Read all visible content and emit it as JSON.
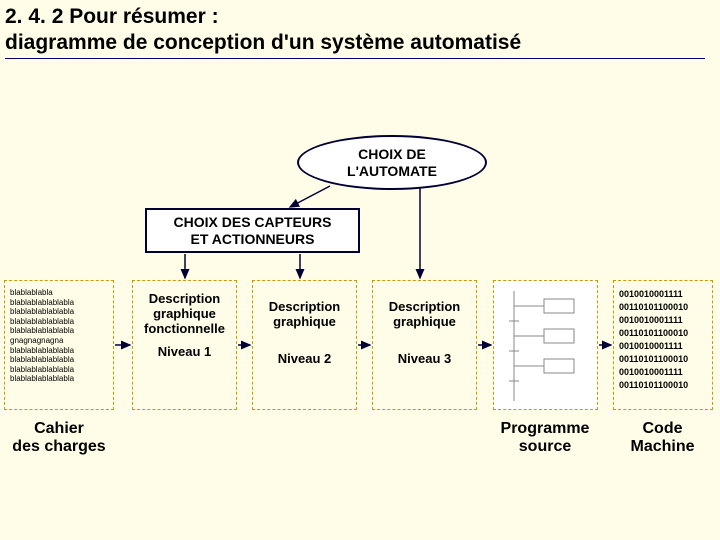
{
  "title_line1": "2. 4. 2 Pour résumer :",
  "title_line2": "diagramme de conception d'un système  automatisé",
  "oval_line1": "CHOIX DE",
  "oval_line2": "L'AUTOMATE",
  "rect_line1": "CHOIX DES CAPTEURS",
  "rect_line2": "ET ACTIONNEURS",
  "cahier_lines": [
    "blablablabla",
    "blablablablablabla",
    "blablablablablabla",
    "blablablablablabla",
    "blablablablablabla",
    "gnagnagnagna",
    "blablablablablabla",
    "blablablablablabla",
    "blablablablablabla",
    "blablablablablabla"
  ],
  "desc1_l1": "Description",
  "desc1_l2": "graphique",
  "desc1_l3": "fonctionnelle",
  "desc2_l1": "Description",
  "desc2_l2": "graphique",
  "desc3_l1": "Description",
  "desc3_l2": "graphique",
  "niveau1": "Niveau 1",
  "niveau2": "Niveau 2",
  "niveau3": "Niveau 3",
  "code_lines": [
    "0010010001111",
    "00110101100010",
    "0010010001111",
    "00110101100010",
    "0010010001111",
    "00110101100010",
    "0010010001111",
    "00110101100010"
  ],
  "cap_cahier_l1": "Cahier",
  "cap_cahier_l2": "des charges",
  "cap_prog_l1": "Programme",
  "cap_prog_l2": "source",
  "cap_code_l1": "Code",
  "cap_code_l2": "Machine"
}
